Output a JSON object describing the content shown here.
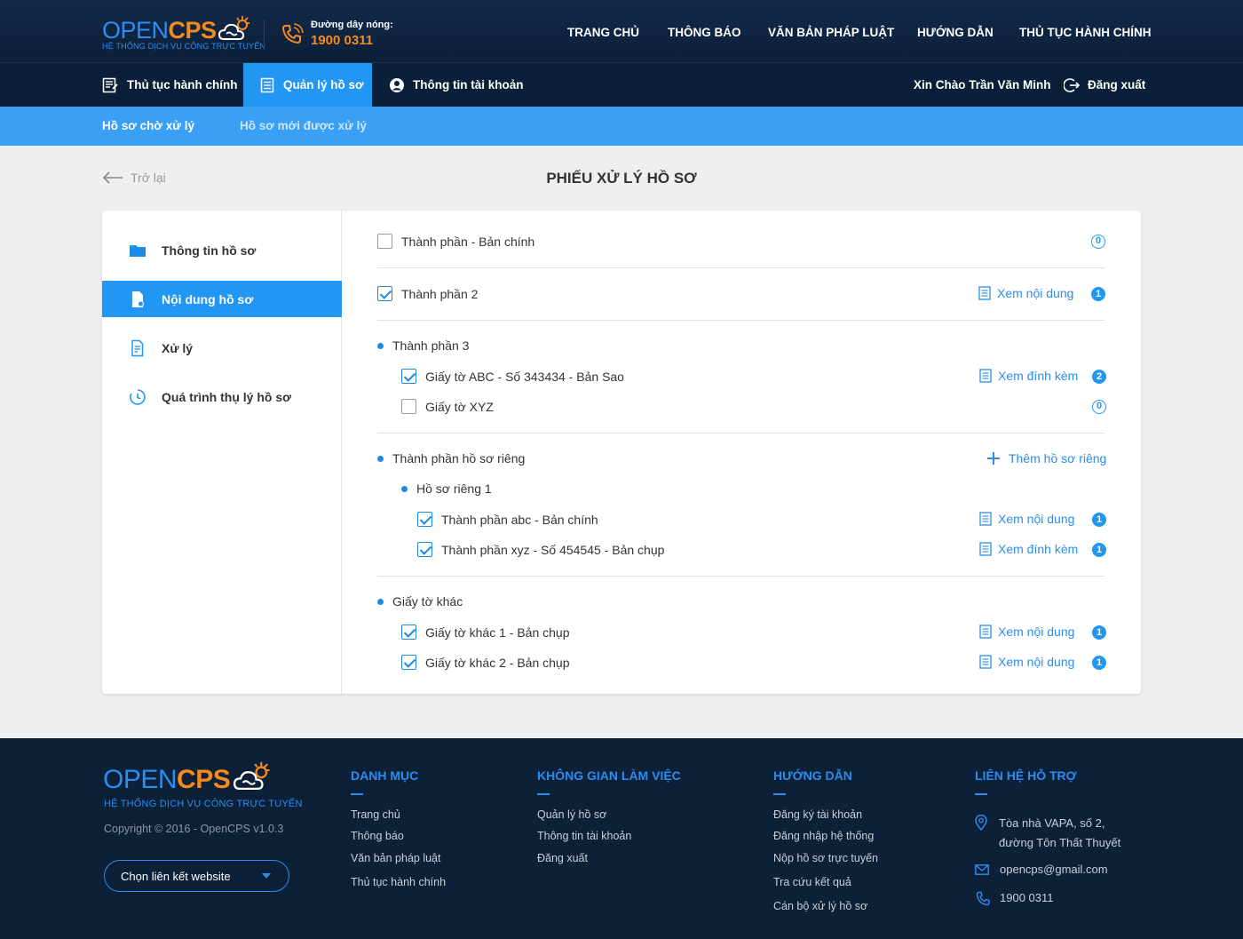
{
  "header": {
    "logo_open": "OPEN",
    "logo_cps": "CPS",
    "logo_tagline": "HỆ THỐNG DỊCH VỤ CÔNG TRỰC TUYẾN",
    "hotline_label": "Đường dây nóng:",
    "hotline_number": "1900 0311",
    "nav": [
      "TRANG CHỦ",
      "THÔNG BÁO",
      "VĂN BẢN PHÁP LUẬT",
      "HƯỚNG DẪN",
      "THỦ TỤC HÀNH CHÍNH"
    ]
  },
  "subnav": {
    "items": [
      {
        "label": "Thủ tục hành chính",
        "icon": "document-list-icon"
      },
      {
        "label": "Quản lý hồ sơ",
        "icon": "document-icon"
      },
      {
        "label": "Thông tin tài khoản",
        "icon": "user-circle-icon"
      }
    ],
    "greeting": "Xin Chào Trần Văn Minh",
    "logout": "Đăng xuất"
  },
  "tabs": [
    "Hồ sơ chờ xử lý",
    "Hồ sơ mới được xử lý"
  ],
  "page": {
    "back": "Trở lại",
    "title": "PHIẾU XỬ LÝ HỒ SƠ"
  },
  "sidebar": [
    {
      "label": "Thông tin hồ sơ",
      "icon": "folder-icon"
    },
    {
      "label": "Nội dung hồ sơ",
      "icon": "file-icon"
    },
    {
      "label": "Xử lý",
      "icon": "file-edit-icon"
    },
    {
      "label": "Quá trình thụ lý hồ sơ",
      "icon": "clock-icon"
    }
  ],
  "content": {
    "r1": {
      "label": "Thành phần  -  Bản chính",
      "count": "0"
    },
    "r2": {
      "label": "Thành phần 2",
      "action": "Xem nội dung",
      "count": "1"
    },
    "g3": {
      "label": "Thành phần 3"
    },
    "r3a": {
      "label": "Giấy tờ ABC  -  Số 343434  -  Bản Sao",
      "action": "Xem đính kèm",
      "count": "2"
    },
    "r3b": {
      "label": "Giấy tờ XYZ",
      "count": "0"
    },
    "g4": {
      "label": "Thành phần hồ sơ riêng",
      "action": "Thêm hồ sơ riêng"
    },
    "g4sub": {
      "label": "Hồ sơ riêng 1"
    },
    "r4a": {
      "label": "Thành phần abc  -  Bản chính",
      "action": "Xem nội dung",
      "count": "1"
    },
    "r4b": {
      "label": "Thành phần xyz  -  Số 454545  -  Bản chụp",
      "action": "Xem đính kèm",
      "count": "1"
    },
    "g5": {
      "label": "Giấy tờ khác"
    },
    "r5a": {
      "label": "Giấy tờ khác 1  -  Bản chụp",
      "action": "Xem nội dung",
      "count": "1"
    },
    "r5b": {
      "label": "Giấy tờ khác 2  -  Bản chụp",
      "action": "Xem nội dung",
      "count": "1"
    }
  },
  "footer": {
    "copyright": "Copyright © 2016 - OpenCPS v1.0.3",
    "select_label": "Chọn liên kết website",
    "col1": {
      "title": "DANH MỤC",
      "links": [
        "Trang chủ",
        "Thông báo",
        "Văn bản pháp luật",
        "Thủ tục hành chính"
      ]
    },
    "col2": {
      "title": "KHÔNG GIAN LÀM VIỆC",
      "links": [
        "Quản lý hồ sơ",
        "Thông tin tài khoản",
        "Đăng xuất"
      ]
    },
    "col3": {
      "title": "HƯỚNG DẪN",
      "links": [
        "Đăng ký tài khoản",
        "Đăng nhập hệ thống",
        "Nộp hồ sơ trực tuyến",
        "Tra cứu kết quả",
        "Cán bộ xử lý hồ sơ"
      ]
    },
    "col4": {
      "title": "LIÊN HỆ HỖ TRỢ",
      "address1": "Tòa nhà VAPA, số 2,",
      "address2": "đường Tôn Thất Thuyết",
      "email": "opencps@gmail.com",
      "phone": "1900 0311"
    }
  },
  "colors": {
    "accent": "#2196f3",
    "orange": "#f58a1f",
    "navy": "#0c2038"
  }
}
